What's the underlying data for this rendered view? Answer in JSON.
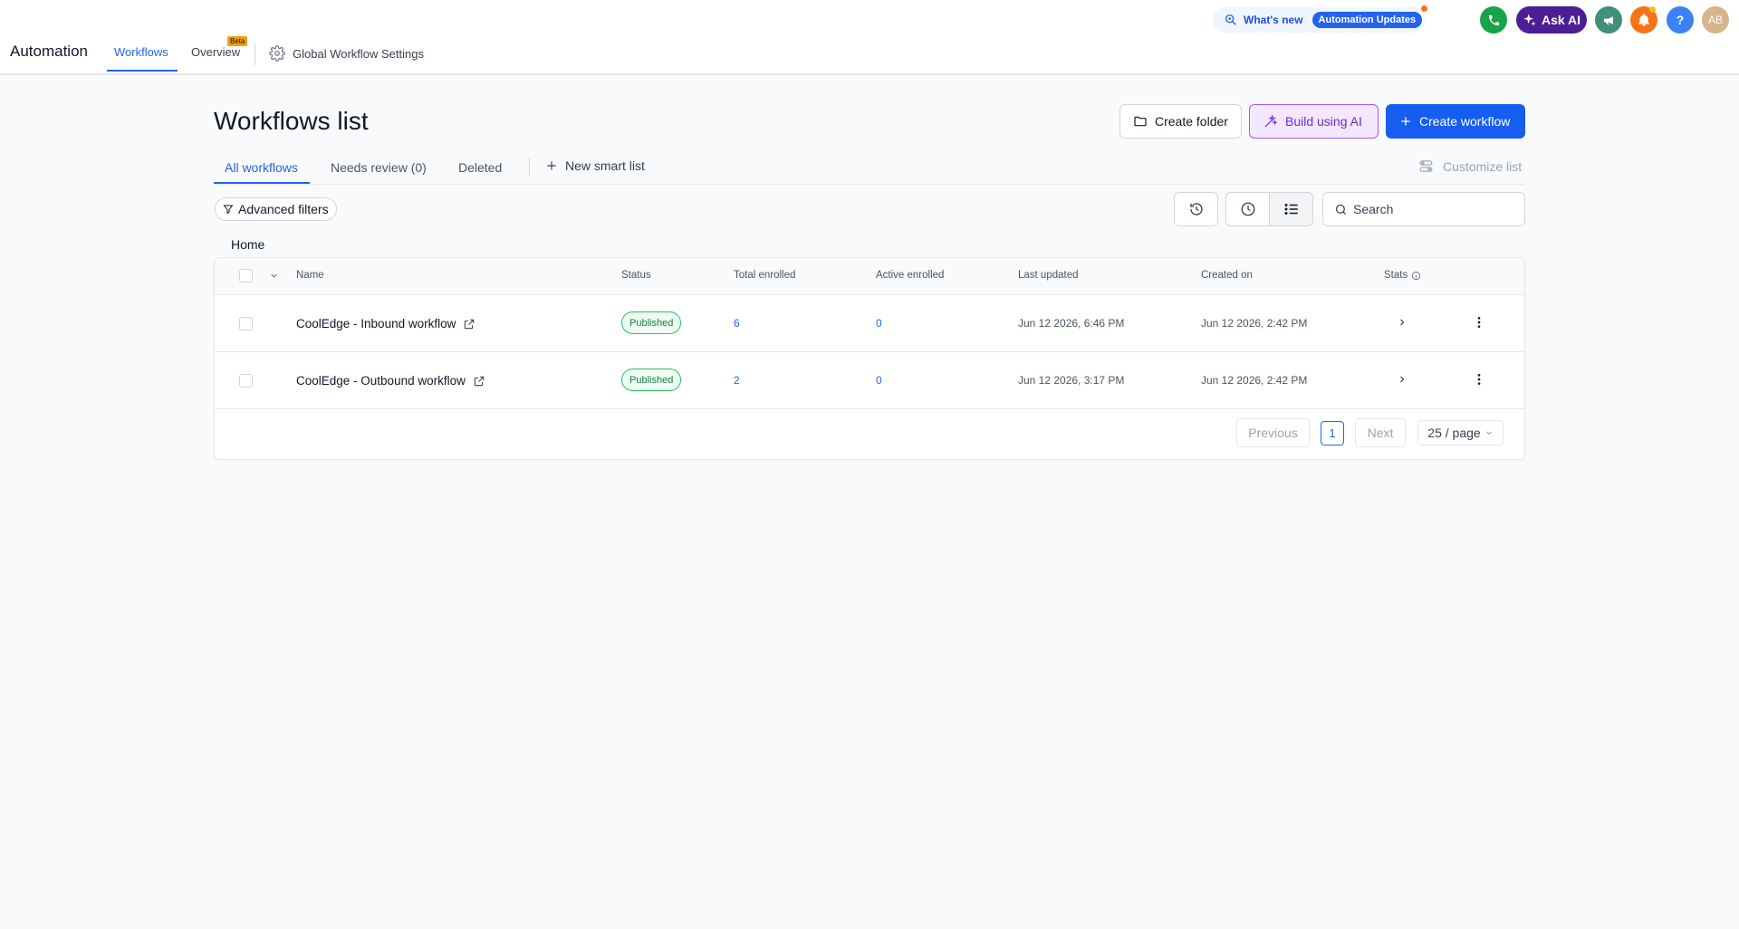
{
  "app": {
    "title": "Automation"
  },
  "nav": {
    "tabs": [
      {
        "label": "Workflows",
        "active": true
      },
      {
        "label": "Overview",
        "badge": "Beta"
      }
    ],
    "global_settings_label": "Global Workflow Settings"
  },
  "topbar": {
    "whats_new_label": "What's new",
    "updates_label": "Automation Updates",
    "ask_ai_label": "Ask AI",
    "avatar_initials": "AB",
    "icons": [
      "phone-icon",
      "sparkle-icon",
      "megaphone-icon",
      "bell-icon",
      "help-icon"
    ]
  },
  "page": {
    "title": "Workflows list",
    "buttons": {
      "create_folder": "Create folder",
      "build_ai": "Build using AI",
      "create_workflow": "Create workflow"
    }
  },
  "subtabs": {
    "all": "All workflows",
    "needs_review": "Needs review (0)",
    "deleted": "Deleted",
    "new_smart_list": "New smart list",
    "customize": "Customize list"
  },
  "filters": {
    "advanced": "Advanced filters",
    "search_placeholder": "Search"
  },
  "breadcrumb": "Home",
  "table": {
    "columns": {
      "name": "Name",
      "status": "Status",
      "total_enrolled": "Total enrolled",
      "active_enrolled": "Active enrolled",
      "last_updated": "Last updated",
      "created_on": "Created on",
      "stats": "Stats"
    },
    "rows": [
      {
        "name": "CoolEdge - Inbound workflow",
        "status": "Published",
        "total_enrolled": "6",
        "active_enrolled": "0",
        "last_updated": "Jun 12 2026, 6:46 PM",
        "created_on": "Jun 12 2026, 2:42 PM"
      },
      {
        "name": "CoolEdge - Outbound workflow",
        "status": "Published",
        "total_enrolled": "2",
        "active_enrolled": "0",
        "last_updated": "Jun 12 2026, 3:17 PM",
        "created_on": "Jun 12 2026, 2:42 PM"
      }
    ]
  },
  "pagination": {
    "previous": "Previous",
    "page": "1",
    "next": "Next",
    "page_size": "25 / page"
  },
  "colors": {
    "accent": "#2563eb",
    "primary_button": "#155eef",
    "ask_ai": "#4c1d95",
    "phone": "#16a34a",
    "megaphone": "#3f8f7a",
    "bell": "#f97316",
    "help": "#3b82f6",
    "published": "#15803d"
  }
}
